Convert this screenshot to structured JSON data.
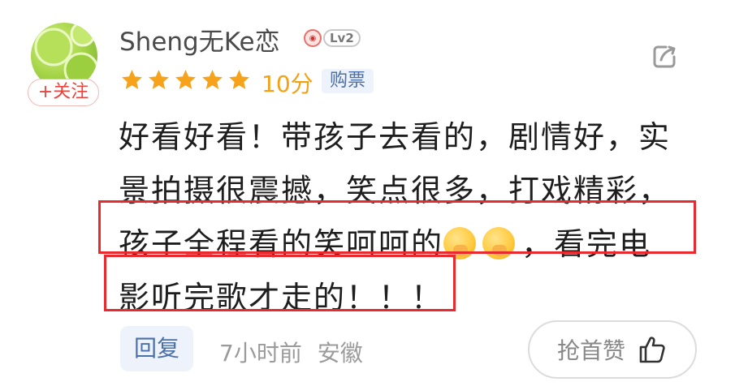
{
  "user": {
    "name": "Sheng无Ke恋",
    "level": "Lv2",
    "follow_label": "+关注"
  },
  "rating": {
    "stars": 5,
    "max_stars": 5,
    "score_text": "10分",
    "tag": "购票"
  },
  "comment": {
    "lines": [
      "好看好看！带孩子去看的，剧情好，实",
      "景拍摄很震撼，笑点很多，打戏精彩，",
      "孩子全程看的笑呵呵的",
      "，看完电",
      "影听完歌才走的！！！"
    ],
    "emoji_icon": "hand-over-mouth-emoji"
  },
  "footer": {
    "reply_label": "回复",
    "time": "7小时前",
    "location": "安徽",
    "like_label": "抢首赞"
  },
  "colors": {
    "highlight_red": "#e8292d",
    "star_orange": "#f3a114",
    "tag_blue": "#4b6fa8",
    "follow_red": "#e8453c"
  },
  "icons": [
    "share-icon",
    "star-icon",
    "thumbs-up-icon",
    "hand-over-mouth-emoji"
  ]
}
